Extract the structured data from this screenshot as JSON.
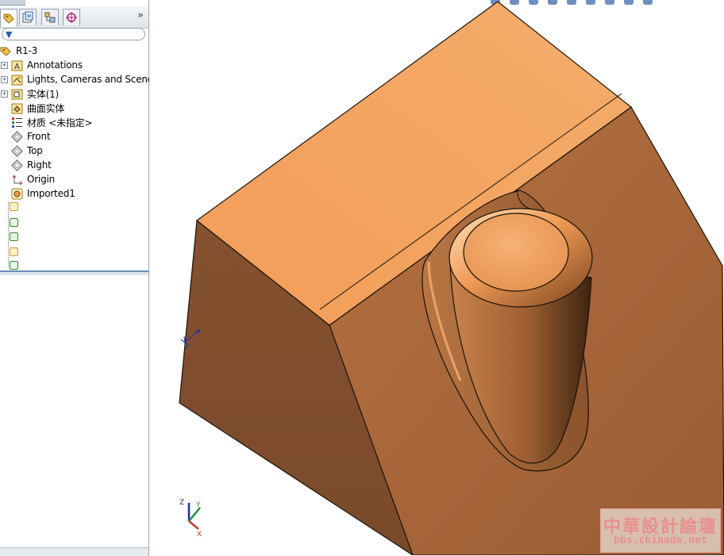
{
  "tree": {
    "root": "R1-3",
    "items": [
      {
        "label": "Annotations",
        "icon": "annotations-folder-icon",
        "expandable": true
      },
      {
        "label": "Lights, Cameras and Scene",
        "icon": "lights-folder-icon",
        "expandable": true
      },
      {
        "label": "实体(1)",
        "icon": "solid-bodies-folder-icon",
        "expandable": true
      },
      {
        "label": "曲面实体",
        "icon": "surface-bodies-folder-icon",
        "expandable": false
      },
      {
        "label": "材质 <未指定>",
        "icon": "material-icon",
        "expandable": false
      },
      {
        "label": "Front",
        "icon": "plane-icon",
        "expandable": false
      },
      {
        "label": "Top",
        "icon": "plane-icon",
        "expandable": false
      },
      {
        "label": "Right",
        "icon": "plane-icon",
        "expandable": false
      },
      {
        "label": "Origin",
        "icon": "origin-icon",
        "expandable": false
      },
      {
        "label": "Imported1",
        "icon": "imported-feature-icon",
        "expandable": false
      }
    ]
  },
  "tabs": [
    "feature-manager",
    "property-manager",
    "configuration-manager",
    "dimxpert-manager"
  ],
  "triad": {
    "x": "X",
    "y": "Y",
    "z": "Z"
  },
  "watermark": {
    "line1": "中華設計論壇",
    "line2": "bbs.chinade.net"
  },
  "colors": {
    "model_light": "#f5a868",
    "model_mid": "#c97b45",
    "model_dark": "#7a4a2b",
    "edge": "#1a1208",
    "accent": "#2a5ca8"
  }
}
